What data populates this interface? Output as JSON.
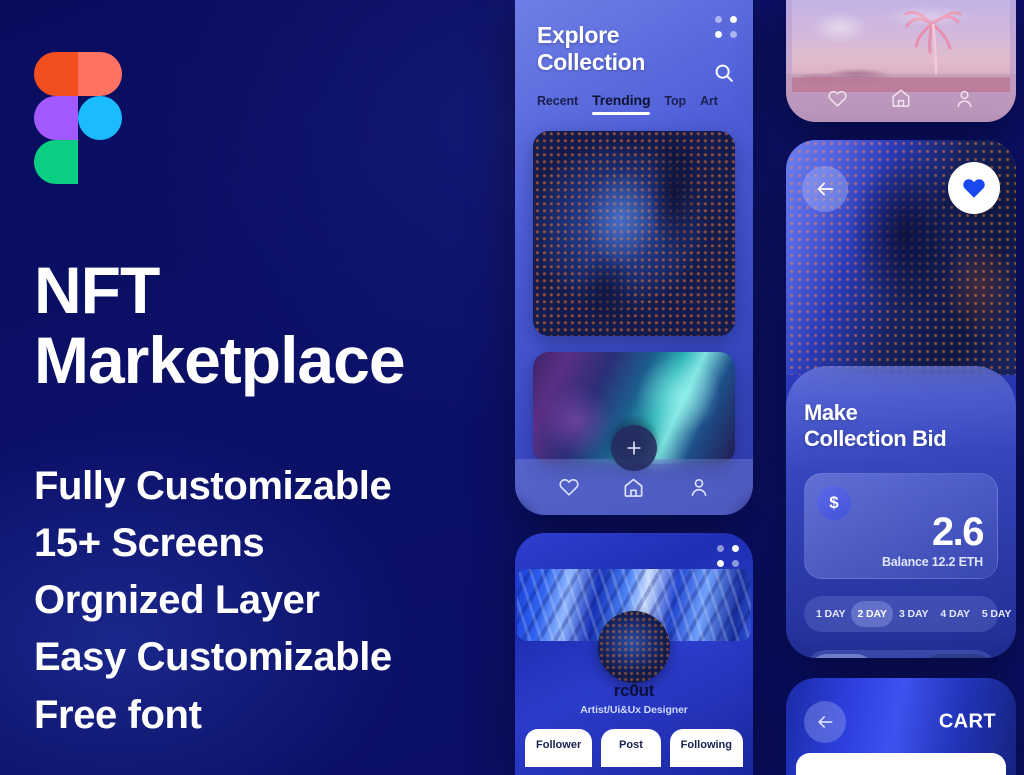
{
  "meta": {
    "background_color": "#0b0f63",
    "accent_blue": "#2f3ecb"
  },
  "left_panel": {
    "logo": {
      "name": "figma-logo",
      "colors": {
        "top_left": "#F24E1E",
        "top_right": "#FF7262",
        "mid_left": "#A259FF",
        "mid_right": "#1ABCFE",
        "bottom_left": "#0ACF83"
      }
    },
    "headline_line1": "NFT",
    "headline_line2": "Marketplace",
    "features": [
      "Fully Customizable",
      "15+ Screens",
      "Orgnized Layer",
      "Easy Customizable",
      "Free font"
    ]
  },
  "phone_explore": {
    "title_line1": "Explore",
    "title_line2": "Collection",
    "grid_icon": "grid-dots-icon",
    "search_icon": "search-icon",
    "tabs": [
      {
        "label": "Recent",
        "active": false
      },
      {
        "label": "Trending",
        "active": true
      },
      {
        "label": "Top",
        "active": false
      },
      {
        "label": "Art",
        "active": false
      }
    ],
    "cards": [
      {
        "name": "nft-card-portrait",
        "alt": "Portrait with glowing orange freckles on blue"
      },
      {
        "name": "nft-card-abstract",
        "alt": "Teal and purple liquid abstract artwork"
      }
    ],
    "fab_label": "+",
    "tabbar": [
      {
        "icon": "heart-icon",
        "label": "Favorites"
      },
      {
        "icon": "home-icon",
        "label": "Home"
      },
      {
        "icon": "person-icon",
        "label": "Profile"
      }
    ]
  },
  "phone_profile": {
    "grid_icon": "grid-dots-icon",
    "banner_alt": "Blue abstract marbled banner",
    "avatar_alt": "Artist portrait avatar",
    "username": "rc0ut",
    "role": "Artist/Ui&Ux Designer",
    "buttons": [
      "Follower",
      "Post",
      "Following"
    ]
  },
  "card_landscape": {
    "image_alt": "Pink palm tree landscape",
    "tabbar": [
      {
        "icon": "heart-icon",
        "label": "Favorites"
      },
      {
        "icon": "home-icon",
        "label": "Home"
      },
      {
        "icon": "person-icon",
        "label": "Profile"
      }
    ]
  },
  "card_bid": {
    "back_icon": "arrow-left-icon",
    "like_icon": "heart-filled-icon",
    "title_line1": "Make",
    "title_line2": "Collection Bid",
    "currency_symbol": "$",
    "amount": "2.6",
    "balance": "Balance 12.2 ETH",
    "duration_options": [
      {
        "label": "1 DAY",
        "selected": false
      },
      {
        "label": "2 DAY",
        "selected": true
      },
      {
        "label": "3 DAY",
        "selected": false
      },
      {
        "label": "4 DAY",
        "selected": false
      },
      {
        "label": "5 DAY",
        "selected": false
      }
    ],
    "cancel_icon": "no-entry-icon",
    "confirm_icon": "check-icon",
    "chevron_icon": "chevron-right-icon",
    "chevron_count": 3
  },
  "card_cart": {
    "back_icon": "arrow-left-icon",
    "title": "CART"
  }
}
